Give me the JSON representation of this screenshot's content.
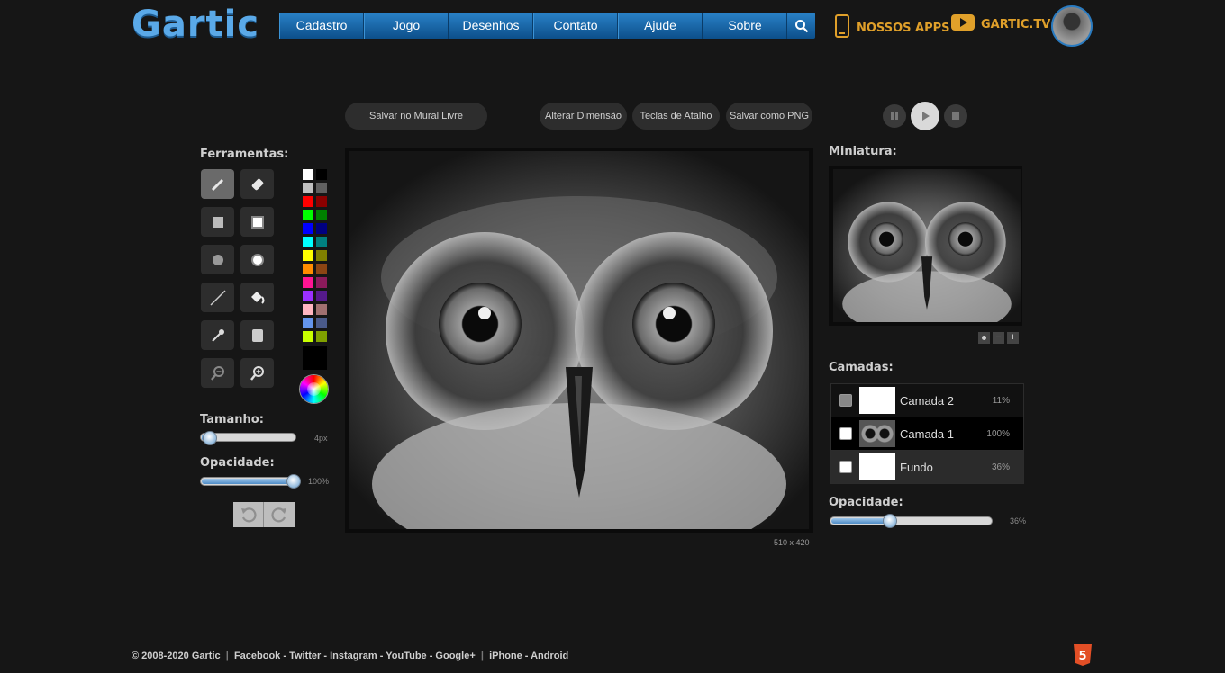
{
  "header": {
    "logo": "Gartic",
    "nav": [
      "Cadastro",
      "Jogo",
      "Desenhos",
      "Contato",
      "Ajude",
      "Sobre"
    ],
    "apps_label": "NOSSOS APPS",
    "tv_label": "GARTIC.TV"
  },
  "toolbar": {
    "save_mural": "Salvar no Mural Livre",
    "alter_dimension": "Alterar Dimensão",
    "shortcuts": "Teclas de Atalho",
    "save_png": "Salvar como PNG"
  },
  "tools": {
    "label": "Ferramentas:",
    "items": [
      "pencil-icon",
      "eraser-icon",
      "filled-rect-icon",
      "outline-rect-icon",
      "filled-circle-icon",
      "outline-circle-icon",
      "line-icon",
      "bucket-icon",
      "eyedropper-icon",
      "text-box-icon",
      "zoom-out-icon",
      "zoom-in-icon"
    ]
  },
  "palette": {
    "colors": [
      [
        "#ffffff",
        "#000000"
      ],
      [
        "#c0c0c0",
        "#606060"
      ],
      [
        "#ff0000",
        "#8b0000"
      ],
      [
        "#00ff00",
        "#008000"
      ],
      [
        "#0000ff",
        "#000080"
      ],
      [
        "#00ffff",
        "#008080"
      ],
      [
        "#ffff00",
        "#808000"
      ],
      [
        "#ff8c00",
        "#8b4513"
      ],
      [
        "#ff1493",
        "#8b1a5b"
      ],
      [
        "#9b30ff",
        "#551a8b"
      ],
      [
        "#ffb6c1",
        "#a07070"
      ],
      [
        "#6495ed",
        "#4a5a8a"
      ],
      [
        "#c8ff00",
        "#80a000"
      ]
    ],
    "current": "#000000"
  },
  "size": {
    "label": "Tamanho:",
    "value": "4px",
    "fraction": 0.03
  },
  "opacity_left": {
    "label": "Opacidade:",
    "value": "100%",
    "fraction": 1.0
  },
  "canvas": {
    "dimensions": "510 x 420"
  },
  "miniature": {
    "label": "Miniatura:"
  },
  "layers": {
    "label": "Camadas:",
    "items": [
      {
        "name": "Camada 2",
        "pct": "11%"
      },
      {
        "name": "Camada 1",
        "pct": "100%"
      },
      {
        "name": "Fundo",
        "pct": "36%"
      }
    ]
  },
  "opacity_right": {
    "label": "Opacidade:",
    "value": "36%",
    "fraction": 0.36
  },
  "footer": {
    "copyright": "© 2008-2020 Gartic",
    "links": "Facebook - Twitter - Instagram - YouTube - Google+",
    "apps": "iPhone - Android"
  }
}
